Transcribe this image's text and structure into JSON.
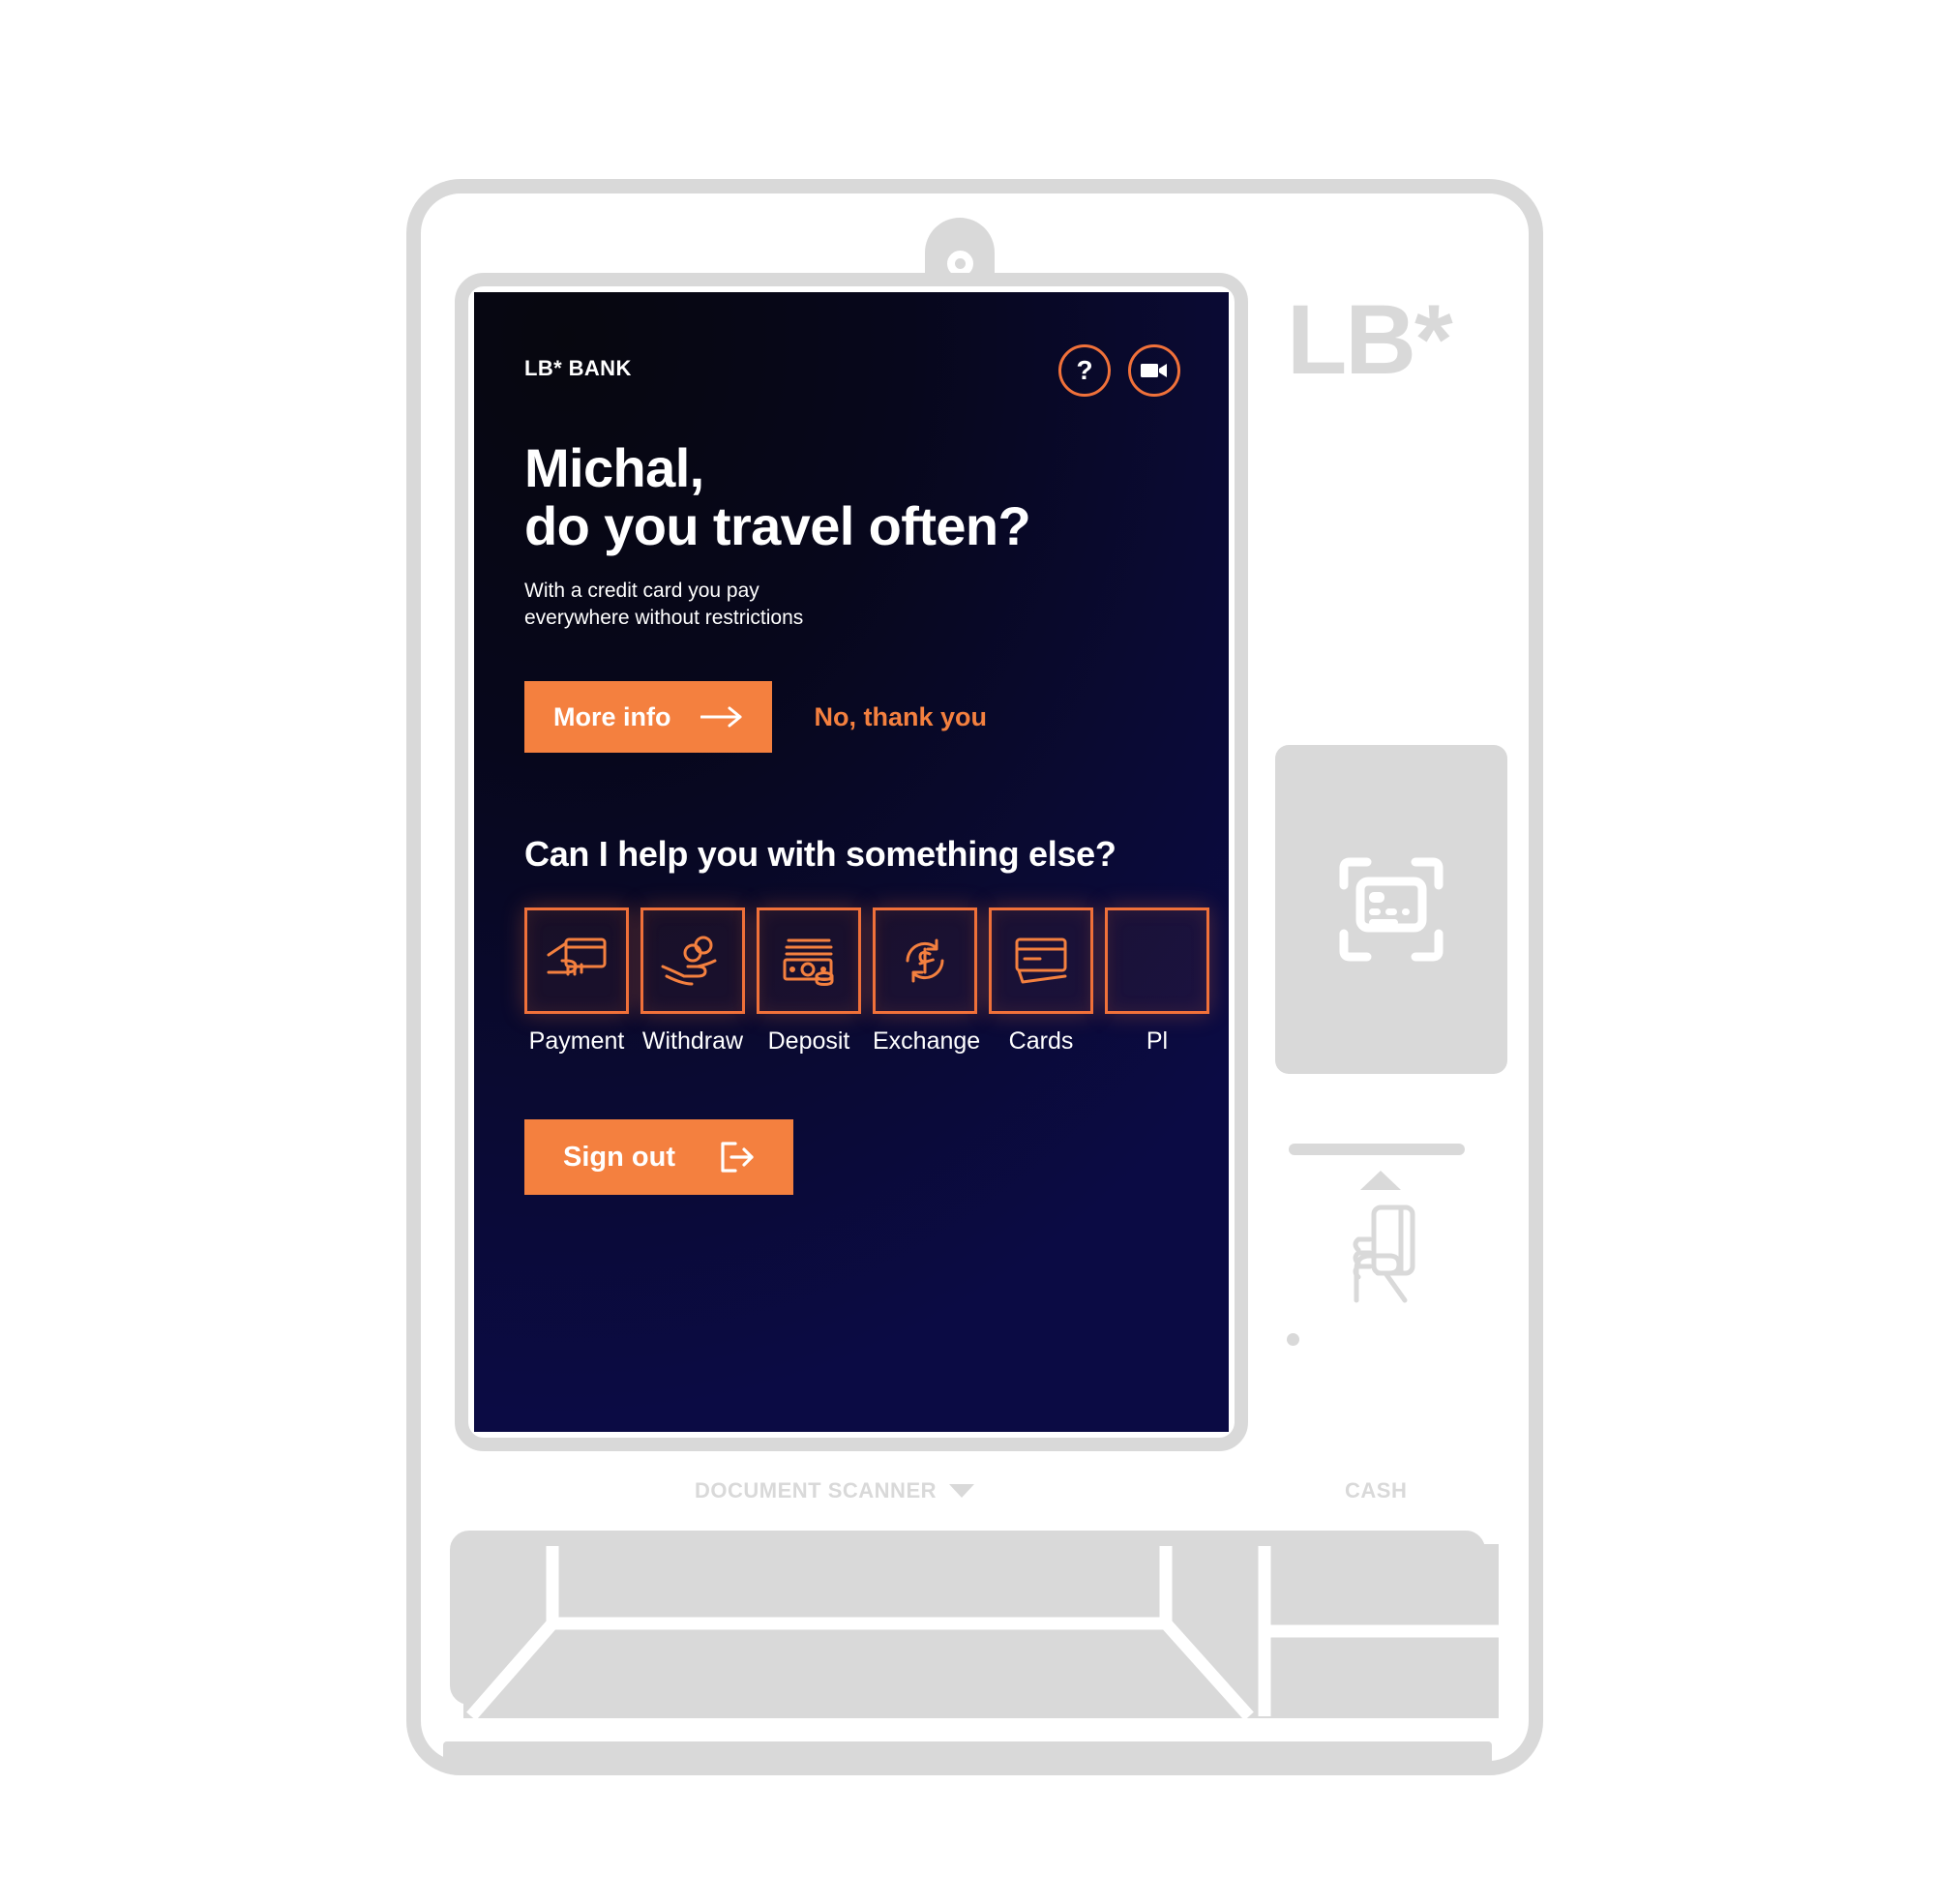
{
  "colors": {
    "accent_orange": "#f4803f",
    "accent_orange_outline": "#f0713a",
    "chassis_grey": "#d9d9d9",
    "screen_top": "#07070f",
    "screen_bottom": "#0b0b44",
    "text_white": "#ffffff"
  },
  "kiosk": {
    "brand_logo": "LB*",
    "labels": {
      "document_scanner": "DOCUMENT SCANNER",
      "cash": "CASH"
    },
    "icons": {
      "camera": "camera-lens-icon",
      "contactless_reader": "contactless-card-scan-icon",
      "card_insert": "hand-insert-card-icon",
      "scanner_caret": "caret-down-icon",
      "status_led": "status-led-dot"
    }
  },
  "screen": {
    "brand": "LB* BANK",
    "header_actions": [
      {
        "name": "help",
        "label": "?",
        "icon": "question-mark-icon"
      },
      {
        "name": "video-call",
        "label": "",
        "icon": "video-camera-icon"
      }
    ],
    "headline_line1": "Michal,",
    "headline_line2": "do you travel often?",
    "subcopy_line1": "With a credit card you pay",
    "subcopy_line2": "everywhere without restrictions",
    "primary_cta": "More info",
    "primary_cta_icon": "arrow-right-icon",
    "secondary_cta": "No, thank you",
    "section_heading": "Can I help you with something else?",
    "services": [
      {
        "label": "Payment",
        "icon": "hand-holding-card-icon"
      },
      {
        "label": "Withdraw",
        "icon": "hand-with-coins-icon"
      },
      {
        "label": "Deposit",
        "icon": "banknotes-coins-icon"
      },
      {
        "label": "Exchange",
        "icon": "currency-exchange-icon"
      },
      {
        "label": "Cards",
        "icon": "stacked-cards-icon"
      },
      {
        "label": "Pl",
        "icon": "clipped-tile-icon"
      }
    ],
    "signout_label": "Sign out",
    "signout_icon": "sign-out-arrow-icon"
  }
}
